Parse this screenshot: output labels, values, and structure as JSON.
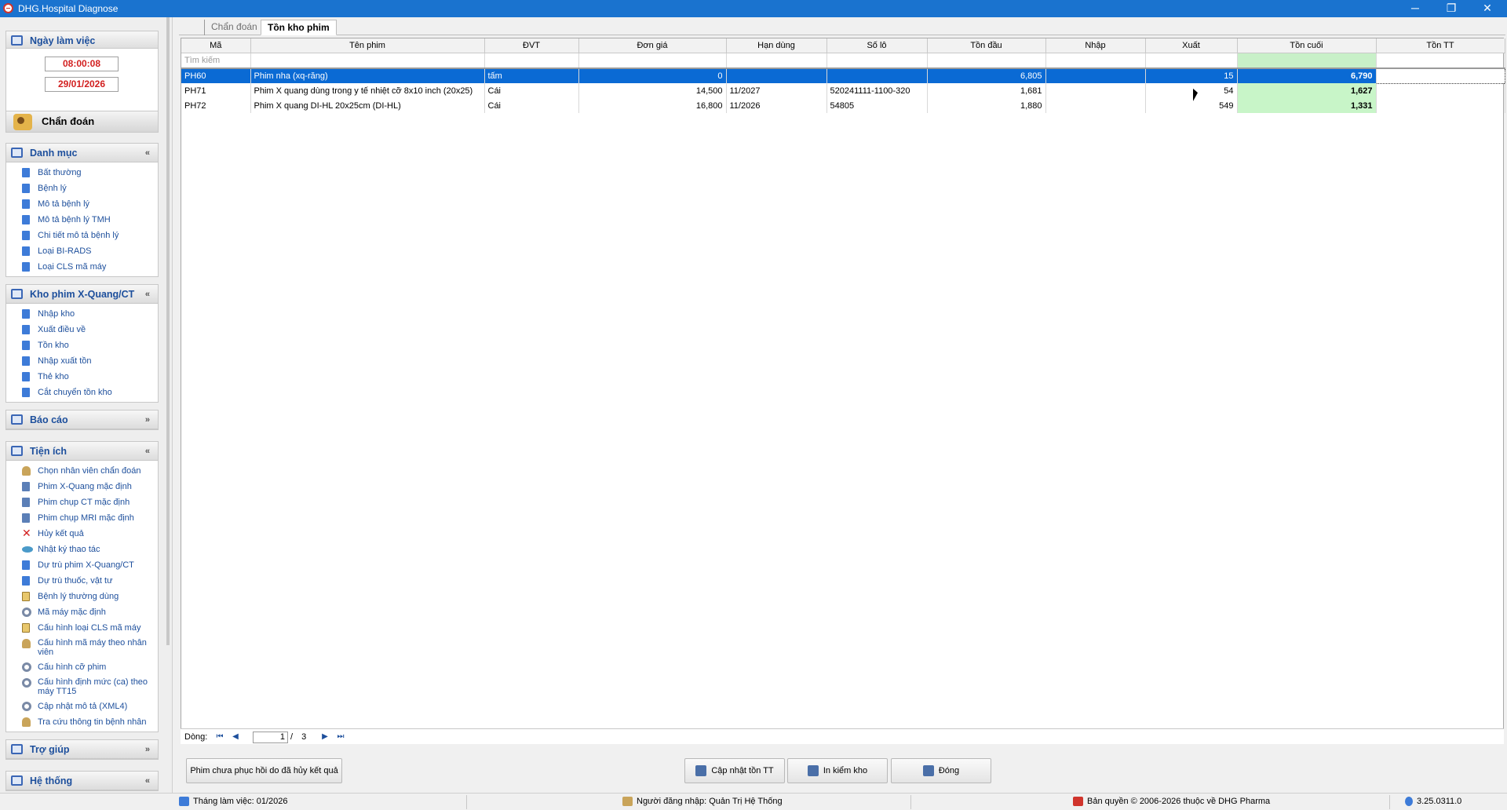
{
  "window": {
    "title": "DHG.Hospital Diagnose",
    "minimize": "─",
    "maximize": "❐",
    "close": "✕"
  },
  "sidebar": {
    "workday_title": "Ngày làm việc",
    "time": "08:00:08",
    "date": "29/01/2026",
    "diagnose_button": "Chẩn đoán",
    "sections": [
      {
        "title": "Danh mục",
        "chevron": "«",
        "items": [
          "Bất thường",
          "Bệnh lý",
          "Mô tả bệnh lý",
          "Mô tả bệnh lý TMH",
          "Chi tiết mô tả bệnh lý",
          "Loại BI-RADS",
          "Loại CLS mã máy"
        ]
      },
      {
        "title": "Kho phim X-Quang/CT",
        "chevron": "«",
        "items": [
          "Nhập kho",
          "Xuất điều về",
          "Tồn kho",
          "Nhập xuất tồn",
          "Thẻ kho",
          "Cắt chuyển tồn kho"
        ]
      },
      {
        "title": "Báo cáo",
        "chevron": "»",
        "items": []
      },
      {
        "title": "Tiện ích",
        "chevron": "«",
        "items": [
          "Chọn nhân viên chẩn đoán",
          "Phim X-Quang mặc định",
          "Phim chụp CT mặc định",
          "Phim chụp MRI mặc định",
          "Hủy kết quả",
          "Nhật ký thao tác",
          "Dự trù phim X-Quang/CT",
          "Dự trù thuốc, vật tư",
          "Bệnh lý thường dùng",
          "Mã máy mặc định",
          "Cấu hình loại CLS mã máy",
          "Cấu hình mã máy theo nhân viên",
          "Cấu hình cỡ phim",
          "Cấu hình định mức (ca) theo máy TT15",
          "Cập nhật mô tả (XML4)",
          "Tra cứu thông tin bệnh nhân"
        ]
      },
      {
        "title": "Trợ giúp",
        "chevron": "»",
        "items": []
      },
      {
        "title": "Hệ thống",
        "chevron": "«",
        "items": []
      }
    ]
  },
  "tabs": [
    {
      "label": "Chẩn đoán",
      "active": false
    },
    {
      "label": "Tồn kho phim",
      "active": true
    }
  ],
  "grid": {
    "columns": [
      "Mã",
      "Tên phim",
      "ĐVT",
      "Đơn giá",
      "Hạn dùng",
      "Số lô",
      "Tồn đầu",
      "Nhập",
      "Xuất",
      "Tồn cuối",
      "Tồn TT"
    ],
    "filter_placeholder": "Tìm kiếm",
    "rows": [
      {
        "ma": "PH60",
        "ten": "Phim nha (xq-răng)",
        "dvt": "tấm",
        "don_gia": "0",
        "han_dung": "",
        "so_lo": "",
        "ton_dau": "6,805",
        "nhap": "",
        "xuat": "15",
        "ton_cuoi": "6,790",
        "ton_tt": "",
        "selected": true
      },
      {
        "ma": "PH71",
        "ten": "Phim X quang dùng trong y tế nhiệt cỡ 8x10 inch (20x25)",
        "dvt": "Cái",
        "don_gia": "14,500",
        "han_dung": "11/2027",
        "so_lo": "520241111-1100-320",
        "ton_dau": "1,681",
        "nhap": "",
        "xuat": "54",
        "ton_cuoi": "1,627",
        "ton_tt": "",
        "selected": false
      },
      {
        "ma": "PH72",
        "ten": "Phim X quang DI-HL 20x25cm (DI-HL)",
        "dvt": "Cái",
        "don_gia": "16,800",
        "han_dung": "11/2026",
        "so_lo": "54805",
        "ton_dau": "1,880",
        "nhap": "",
        "xuat": "549",
        "ton_cuoi": "1,331",
        "ton_tt": "",
        "selected": false
      }
    ]
  },
  "pager": {
    "label": "Dòng:",
    "current": "1",
    "separator": "/",
    "total": "3",
    "first": "⏮",
    "prev": "◀",
    "next": "▶",
    "last": "⏭"
  },
  "buttons": {
    "unrecovered": "Phim chưa phục hồi do đã hủy kết quả",
    "update": "Cập nhật tồn TT",
    "print": "In kiểm kho",
    "close": "Đóng"
  },
  "statusbar": {
    "month": "Tháng làm việc: 01/2026",
    "user": "Người đăng nhập: Quản Trị Hệ Thống",
    "copyright": "Bản quyền © 2006-2026 thuộc về DHG Pharma",
    "version": "3.25.0311.0"
  }
}
